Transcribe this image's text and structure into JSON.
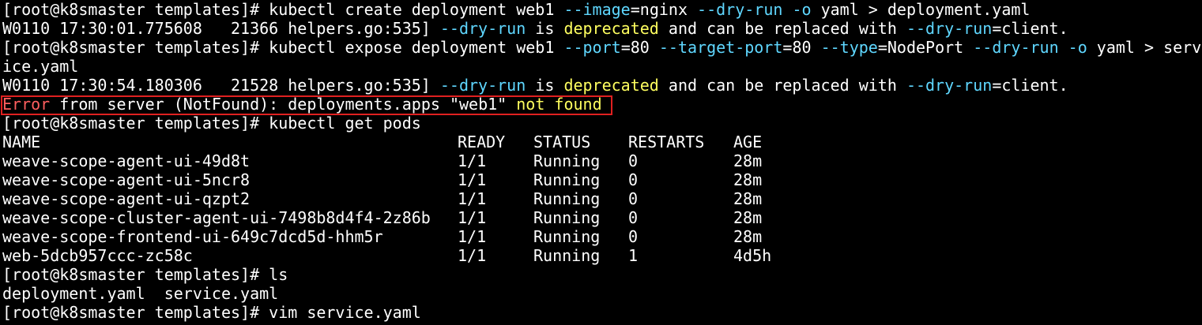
{
  "lines": {
    "l1": {
      "prompt": "[root@k8smaster templates]# ",
      "cmd1": "kubectl create deployment web1 ",
      "opt1": "--image",
      "v1": "=nginx ",
      "opt2": "--dry-run -o",
      "v2": " yaml > deployment.yaml"
    },
    "l2": {
      "pre": "W0110 17:30:01.775608   21366 helpers.go:535] ",
      "opt1": "--dry-run",
      "mid": " is ",
      "dep": "deprecated",
      "post": " and can be replaced with ",
      "opt2": "--dry-run",
      "end": "=client."
    },
    "l3": {
      "prompt": "[root@k8smaster templates]# ",
      "cmd1": "kubectl expose deployment web1 ",
      "opt1": "--port",
      "v1": "=80 ",
      "opt2": "--target-port",
      "v2": "=80 ",
      "opt3": "--type",
      "v3": "=NodePort ",
      "opt4": "--dry-run -o",
      "v4": " yaml > serv"
    },
    "l4": "ice.yaml",
    "l5": {
      "pre": "W0110 17:30:54.180306   21528 helpers.go:535] ",
      "opt1": "--dry-run",
      "mid": " is ",
      "dep": "deprecated",
      "post": " and can be replaced with ",
      "opt2": "--dry-run",
      "end": "=client."
    },
    "l6": {
      "err": "Error",
      "mid": " from server (NotFound): deployments.apps \"web1\" ",
      "nf": "not found"
    },
    "l7": "[root@k8smaster templates]# kubectl get pods",
    "l16": "[root@k8smaster templates]# ls",
    "l17": "deployment.yaml  service.yaml",
    "l18": "[root@k8smaster templates]# vim service.yaml"
  },
  "pods_table": {
    "headers": [
      "NAME",
      "READY",
      "STATUS",
      "RESTARTS",
      "AGE"
    ],
    "rows": [
      [
        "weave-scope-agent-ui-49d8t",
        "1/1",
        "Running",
        "0",
        "28m"
      ],
      [
        "weave-scope-agent-ui-5ncr8",
        "1/1",
        "Running",
        "0",
        "28m"
      ],
      [
        "weave-scope-agent-ui-qzpt2",
        "1/1",
        "Running",
        "0",
        "28m"
      ],
      [
        "weave-scope-cluster-agent-ui-7498b8d4f4-2z86b",
        "1/1",
        "Running",
        "0",
        "28m"
      ],
      [
        "weave-scope-frontend-ui-649c7dcd5d-hhm5r",
        "1/1",
        "Running",
        "0",
        "28m"
      ],
      [
        "web-5dcb957ccc-zc58c",
        "1/1",
        "Running",
        "1",
        "4d5h"
      ]
    ]
  },
  "colors": {
    "background": "#000000",
    "text": "#ffffff",
    "option": "#5fd7ff",
    "warning_word": "#ffff5f",
    "error_word": "#ff5f5f",
    "highlight_border": "#e02020"
  }
}
